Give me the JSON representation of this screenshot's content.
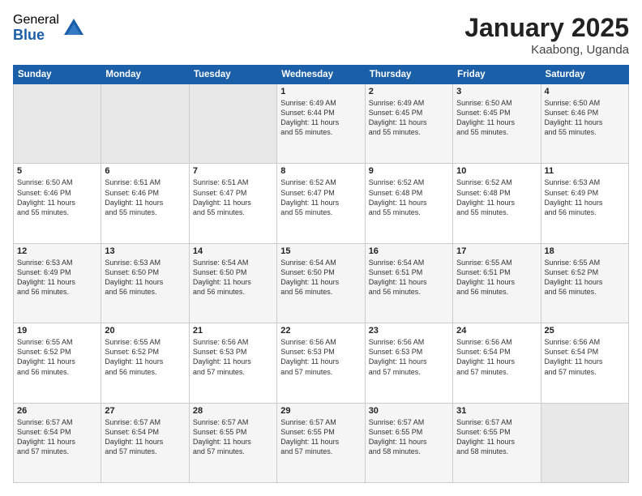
{
  "logo": {
    "general": "General",
    "blue": "Blue"
  },
  "header": {
    "month": "January 2025",
    "location": "Kaabong, Uganda"
  },
  "weekdays": [
    "Sunday",
    "Monday",
    "Tuesday",
    "Wednesday",
    "Thursday",
    "Friday",
    "Saturday"
  ],
  "weeks": [
    [
      {
        "day": "",
        "info": ""
      },
      {
        "day": "",
        "info": ""
      },
      {
        "day": "",
        "info": ""
      },
      {
        "day": "1",
        "info": "Sunrise: 6:49 AM\nSunset: 6:44 PM\nDaylight: 11 hours\nand 55 minutes."
      },
      {
        "day": "2",
        "info": "Sunrise: 6:49 AM\nSunset: 6:45 PM\nDaylight: 11 hours\nand 55 minutes."
      },
      {
        "day": "3",
        "info": "Sunrise: 6:50 AM\nSunset: 6:45 PM\nDaylight: 11 hours\nand 55 minutes."
      },
      {
        "day": "4",
        "info": "Sunrise: 6:50 AM\nSunset: 6:46 PM\nDaylight: 11 hours\nand 55 minutes."
      }
    ],
    [
      {
        "day": "5",
        "info": "Sunrise: 6:50 AM\nSunset: 6:46 PM\nDaylight: 11 hours\nand 55 minutes."
      },
      {
        "day": "6",
        "info": "Sunrise: 6:51 AM\nSunset: 6:46 PM\nDaylight: 11 hours\nand 55 minutes."
      },
      {
        "day": "7",
        "info": "Sunrise: 6:51 AM\nSunset: 6:47 PM\nDaylight: 11 hours\nand 55 minutes."
      },
      {
        "day": "8",
        "info": "Sunrise: 6:52 AM\nSunset: 6:47 PM\nDaylight: 11 hours\nand 55 minutes."
      },
      {
        "day": "9",
        "info": "Sunrise: 6:52 AM\nSunset: 6:48 PM\nDaylight: 11 hours\nand 55 minutes."
      },
      {
        "day": "10",
        "info": "Sunrise: 6:52 AM\nSunset: 6:48 PM\nDaylight: 11 hours\nand 55 minutes."
      },
      {
        "day": "11",
        "info": "Sunrise: 6:53 AM\nSunset: 6:49 PM\nDaylight: 11 hours\nand 56 minutes."
      }
    ],
    [
      {
        "day": "12",
        "info": "Sunrise: 6:53 AM\nSunset: 6:49 PM\nDaylight: 11 hours\nand 56 minutes."
      },
      {
        "day": "13",
        "info": "Sunrise: 6:53 AM\nSunset: 6:50 PM\nDaylight: 11 hours\nand 56 minutes."
      },
      {
        "day": "14",
        "info": "Sunrise: 6:54 AM\nSunset: 6:50 PM\nDaylight: 11 hours\nand 56 minutes."
      },
      {
        "day": "15",
        "info": "Sunrise: 6:54 AM\nSunset: 6:50 PM\nDaylight: 11 hours\nand 56 minutes."
      },
      {
        "day": "16",
        "info": "Sunrise: 6:54 AM\nSunset: 6:51 PM\nDaylight: 11 hours\nand 56 minutes."
      },
      {
        "day": "17",
        "info": "Sunrise: 6:55 AM\nSunset: 6:51 PM\nDaylight: 11 hours\nand 56 minutes."
      },
      {
        "day": "18",
        "info": "Sunrise: 6:55 AM\nSunset: 6:52 PM\nDaylight: 11 hours\nand 56 minutes."
      }
    ],
    [
      {
        "day": "19",
        "info": "Sunrise: 6:55 AM\nSunset: 6:52 PM\nDaylight: 11 hours\nand 56 minutes."
      },
      {
        "day": "20",
        "info": "Sunrise: 6:55 AM\nSunset: 6:52 PM\nDaylight: 11 hours\nand 56 minutes."
      },
      {
        "day": "21",
        "info": "Sunrise: 6:56 AM\nSunset: 6:53 PM\nDaylight: 11 hours\nand 57 minutes."
      },
      {
        "day": "22",
        "info": "Sunrise: 6:56 AM\nSunset: 6:53 PM\nDaylight: 11 hours\nand 57 minutes."
      },
      {
        "day": "23",
        "info": "Sunrise: 6:56 AM\nSunset: 6:53 PM\nDaylight: 11 hours\nand 57 minutes."
      },
      {
        "day": "24",
        "info": "Sunrise: 6:56 AM\nSunset: 6:54 PM\nDaylight: 11 hours\nand 57 minutes."
      },
      {
        "day": "25",
        "info": "Sunrise: 6:56 AM\nSunset: 6:54 PM\nDaylight: 11 hours\nand 57 minutes."
      }
    ],
    [
      {
        "day": "26",
        "info": "Sunrise: 6:57 AM\nSunset: 6:54 PM\nDaylight: 11 hours\nand 57 minutes."
      },
      {
        "day": "27",
        "info": "Sunrise: 6:57 AM\nSunset: 6:54 PM\nDaylight: 11 hours\nand 57 minutes."
      },
      {
        "day": "28",
        "info": "Sunrise: 6:57 AM\nSunset: 6:55 PM\nDaylight: 11 hours\nand 57 minutes."
      },
      {
        "day": "29",
        "info": "Sunrise: 6:57 AM\nSunset: 6:55 PM\nDaylight: 11 hours\nand 57 minutes."
      },
      {
        "day": "30",
        "info": "Sunrise: 6:57 AM\nSunset: 6:55 PM\nDaylight: 11 hours\nand 58 minutes."
      },
      {
        "day": "31",
        "info": "Sunrise: 6:57 AM\nSunset: 6:55 PM\nDaylight: 11 hours\nand 58 minutes."
      },
      {
        "day": "",
        "info": ""
      }
    ]
  ]
}
